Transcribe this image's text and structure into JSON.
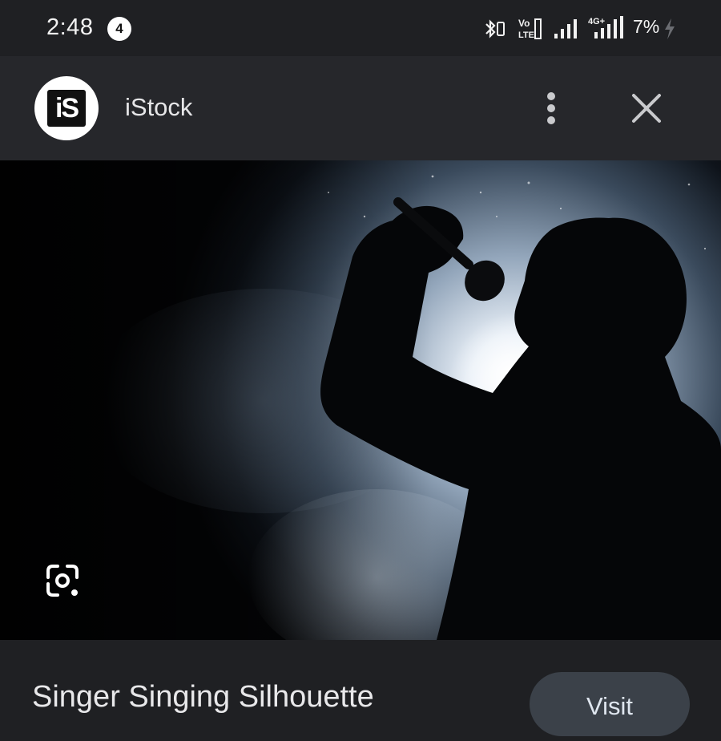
{
  "status_bar": {
    "time": "2:48",
    "notification_count": "4",
    "battery_percent": "7%",
    "network_labels": [
      "VoLTE",
      "4G+"
    ],
    "icons": [
      "bluetooth-icon",
      "volte-icon",
      "signal-icon",
      "4g-signal-icon",
      "battery-charging-icon"
    ]
  },
  "header": {
    "source_name": "iStock",
    "logo_text": "iS"
  },
  "image": {
    "title": "Singer Singing Silhouette",
    "lens_icon": "google-lens-icon"
  },
  "actions": {
    "visit_label": "Visit"
  },
  "colors": {
    "background": "#1f2023",
    "header": "#26272b",
    "visit_button": "#3b4149"
  }
}
